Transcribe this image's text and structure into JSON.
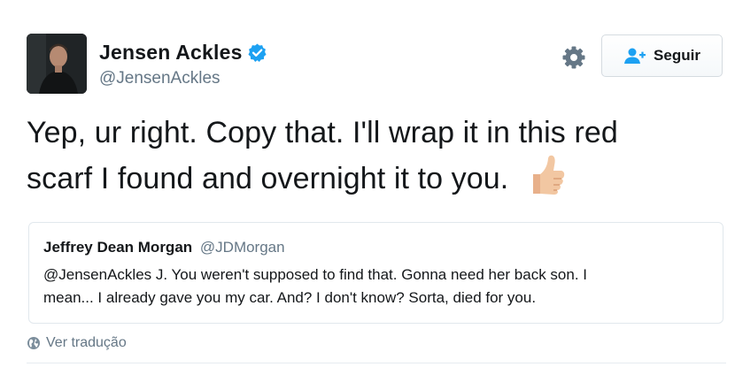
{
  "author": {
    "display_name": "Jensen Ackles",
    "handle": "@JensenAckles",
    "verified": true
  },
  "header": {
    "follow_label": "Seguir",
    "settings_icon": "gear-icon",
    "follow_icon": "user-plus-icon"
  },
  "tweet": {
    "lines": [
      "Yep, ur right.  Copy that.  I'll wrap it in this red",
      "scarf I found and overnight it to you."
    ],
    "emoji": "thumbs-up-icon"
  },
  "quote": {
    "display_name": "Jeffrey Dean Morgan",
    "handle": "@JDMorgan",
    "lines": [
      "@JensenAckles J. You weren't supposed to find that. Gonna need her back son. I",
      "mean... I already gave you my car. And? I don't know? Sorta, died for you."
    ]
  },
  "translate": {
    "label": "Ver tradução",
    "icon": "globe-icon"
  },
  "colors": {
    "text": "#14171a",
    "secondary": "#657786",
    "verified": "#1da1f2",
    "follow_icon": "#1da1f2",
    "border": "#e1e8ed"
  }
}
